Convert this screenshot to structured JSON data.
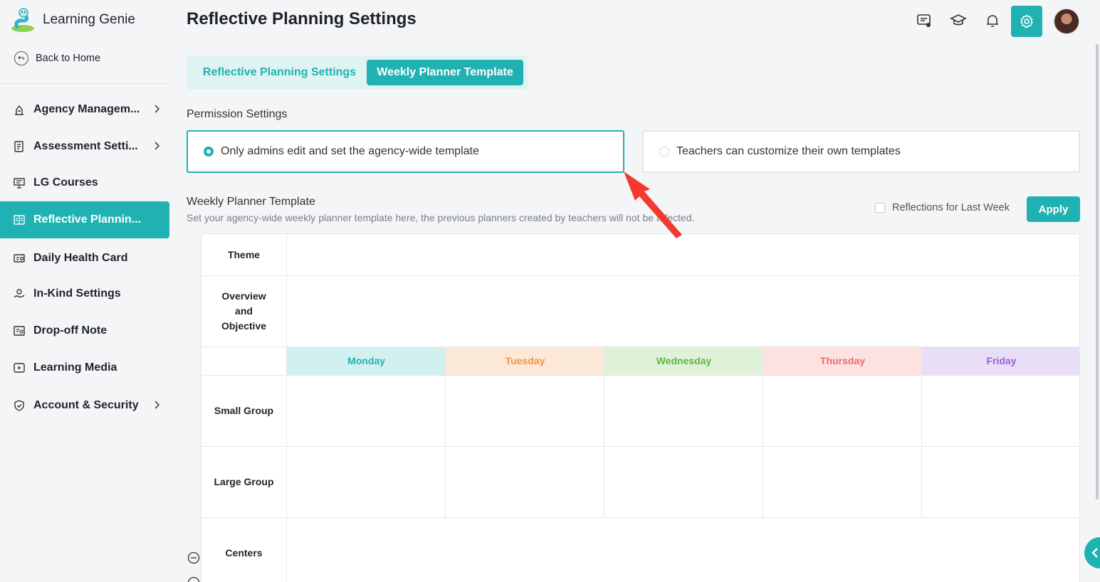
{
  "brand": {
    "name": "Learning Genie"
  },
  "sidebar": {
    "back_label": "Back to Home",
    "items": [
      {
        "label": "Agency Managem...",
        "icon": "building-icon",
        "chevron": true
      },
      {
        "label": "Assessment Setti...",
        "icon": "assessment-icon",
        "chevron": true
      },
      {
        "label": "LG Courses",
        "icon": "courses-icon",
        "chevron": false
      },
      {
        "label": "Reflective Plannin...",
        "icon": "planning-icon",
        "chevron": false,
        "active": true
      },
      {
        "label": "Daily Health Card",
        "icon": "health-card-icon",
        "chevron": false
      },
      {
        "label": "In-Kind Settings",
        "icon": "in-kind-icon",
        "chevron": false
      },
      {
        "label": "Drop-off Note",
        "icon": "note-icon",
        "chevron": false
      },
      {
        "label": "Learning Media",
        "icon": "media-icon",
        "chevron": false
      },
      {
        "label": "Account & Security",
        "icon": "shield-icon",
        "chevron": true
      }
    ]
  },
  "header": {
    "title": "Reflective Planning Settings"
  },
  "tabs": [
    {
      "label": "Reflective Planning Settings",
      "active": false
    },
    {
      "label": "Weekly Planner Template",
      "active": true
    }
  ],
  "permission": {
    "title": "Permission Settings",
    "options": [
      {
        "label": "Only admins edit and set the agency-wide template",
        "selected": true
      },
      {
        "label": "Teachers can customize their own templates",
        "selected": false
      }
    ]
  },
  "planner": {
    "title": "Weekly Planner Template",
    "description": "Set your agency-wide weekly planner template here, the previous planners created by teachers will not be affected.",
    "reflections_label": "Reflections for Last Week",
    "apply_label": "Apply",
    "rows": {
      "theme": "Theme",
      "overview": "Overview and Objective",
      "small_group": "Small Group",
      "large_group": "Large Group",
      "centers": "Centers"
    },
    "days": [
      {
        "label": "Monday",
        "bg": "#d3f0f0",
        "color": "#20b2b2"
      },
      {
        "label": "Tuesday",
        "bg": "#fce8d7",
        "color": "#f0953a"
      },
      {
        "label": "Wednesday",
        "bg": "#dff2d8",
        "color": "#5cb83f"
      },
      {
        "label": "Thursday",
        "bg": "#fde2e2",
        "color": "#ee6b6b"
      },
      {
        "label": "Friday",
        "bg": "#e9def7",
        "color": "#9b5ed6"
      }
    ]
  },
  "colors": {
    "accent": "#20b2b2"
  }
}
